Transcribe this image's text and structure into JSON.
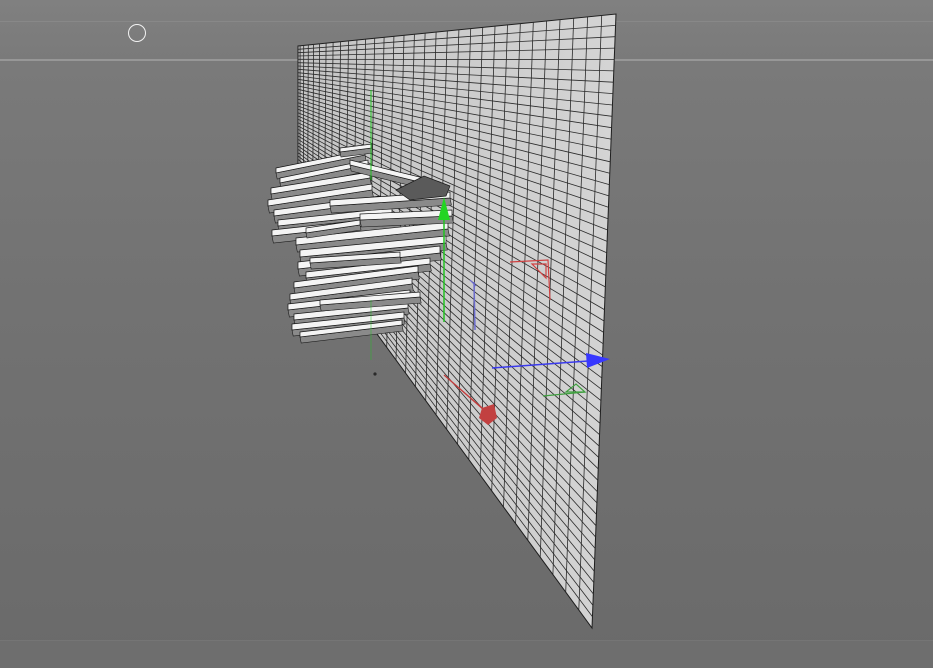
{
  "viewport": {
    "background_color": "#727272",
    "plane_color": "#cfcfcf",
    "grid_line_color": "#2a2a2a",
    "axis_colors": {
      "x": "#d23b3b",
      "y": "#22c322",
      "z": "#3a3aee"
    },
    "icons": {
      "view_toggle": "circle-outline-icon",
      "gizmo": "move-gizmo-icon"
    }
  },
  "scene": {
    "plane_grid": {
      "columns": 32,
      "rows": 54
    },
    "fragment_count": 24
  }
}
